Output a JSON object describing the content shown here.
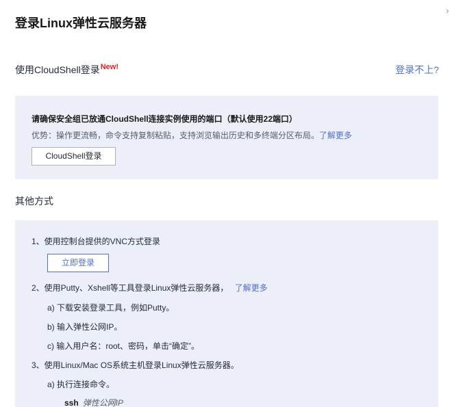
{
  "dialog": {
    "title": "登录Linux弹性云服务器",
    "close_glyph": "›"
  },
  "cloudshell": {
    "label": "使用CloudShell登录",
    "badge": "New!",
    "help_link": "登录不上?",
    "notice": "请确保安全组已放通CloudShell连接实例使用的端口（默认使用22端口）",
    "advantage": "优势：操作更流畅，命令支持复制粘贴，支持浏览输出历史和多终端分区布局。",
    "learn_more": "了解更多",
    "login_button": "CloudShell登录"
  },
  "other": {
    "heading": "其他方式",
    "step1": "1、使用控制台提供的VNC方式登录",
    "login_now_button": "立即登录",
    "step2": "2、使用Putty、Xshell等工具登录Linux弹性云服务器，",
    "step2_link": "了解更多",
    "step2a": "a) 下载安装登录工具，例如Putty。",
    "step2b": "b) 输入弹性公网IP。",
    "step2c": "c) 输入用户名：root、密码，单击“确定”。",
    "step3": "3、使用Linux/Mac OS系统主机登录Linux弹性云服务器。",
    "step3a": "a) 执行连接命令。",
    "ssh_cmd": "ssh",
    "ssh_arg": "弹性公网IP"
  }
}
